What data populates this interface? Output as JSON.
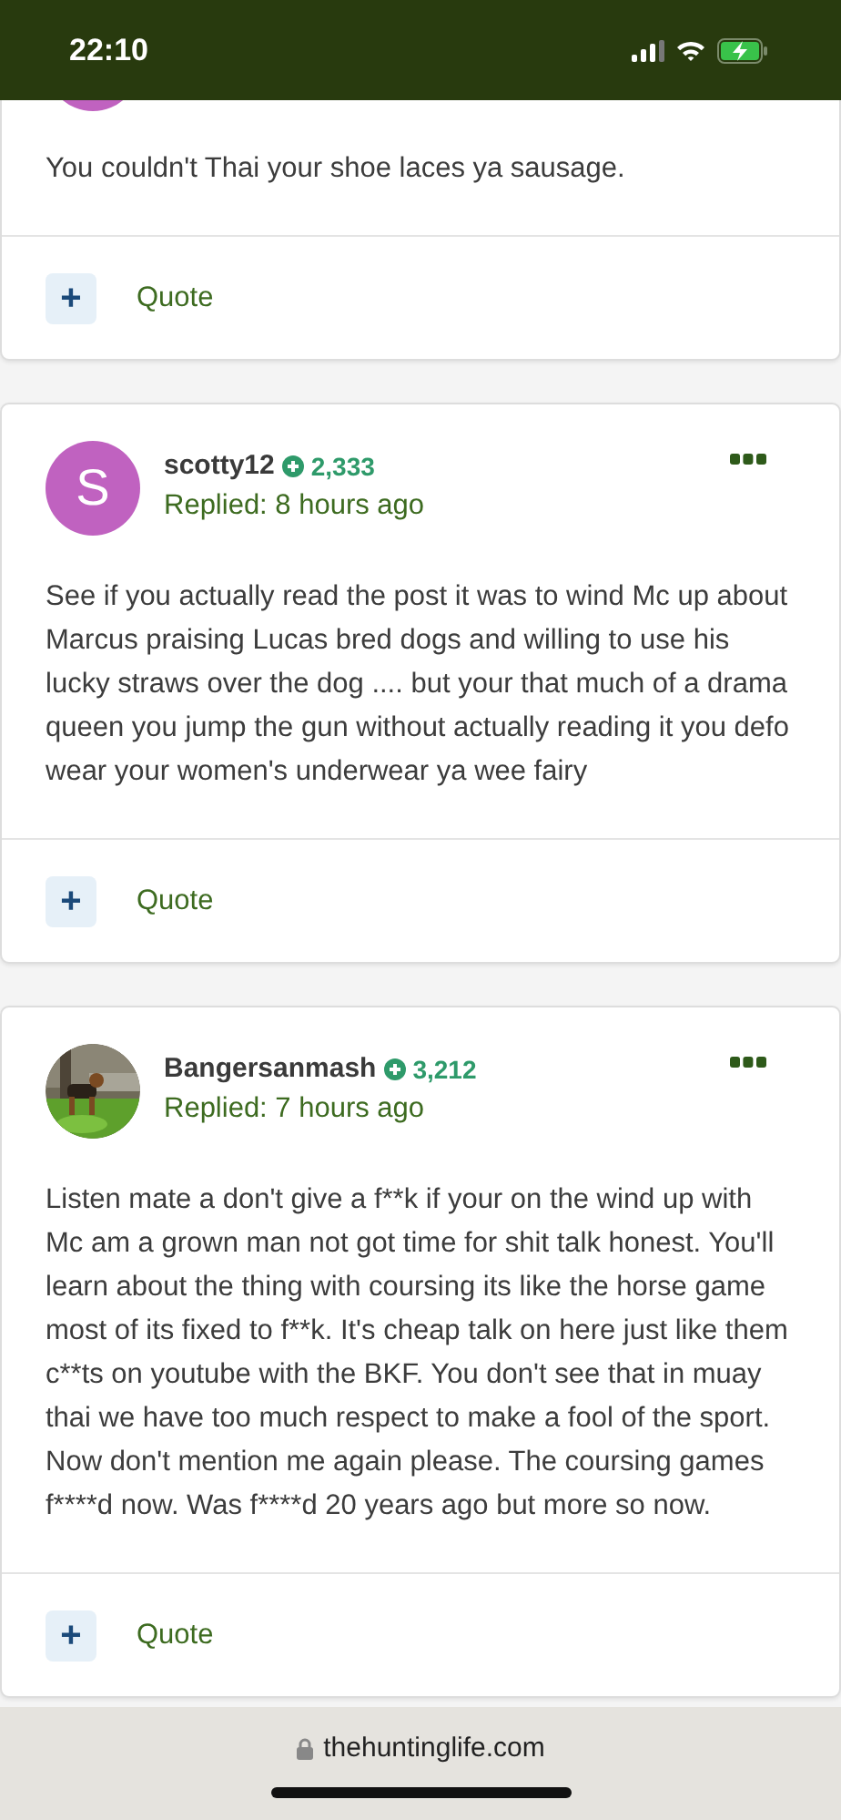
{
  "status_bar": {
    "time": "22:10",
    "battery_charging": true
  },
  "posts": [
    {
      "avatar": {
        "kind": "initial",
        "color": "#c062c0"
      },
      "body": "You couldn't Thai your shoe laces ya sausage.",
      "quote_label": "Quote",
      "quote_icon": "+"
    },
    {
      "avatar": {
        "kind": "initial",
        "letter": "S",
        "color": "#c062c0"
      },
      "author": "scotty12",
      "points": "2,333",
      "replied": "Replied: 8 hours ago",
      "body": "See if you actually read the post it was to wind Mc up about Marcus praising Lucas bred dogs and willing to use his lucky straws over the dog .... but your that much of a drama queen you jump the gun without actually reading it you defo wear your women's underwear ya wee fairy",
      "quote_label": "Quote",
      "quote_icon": "+"
    },
    {
      "author": "Bangersanmash",
      "points": "3,212",
      "replied": "Replied: 7 hours ago",
      "body": "Listen mate a don't give a f**k if your on the wind up with Mc am a grown man not got time for shit talk honest. You'll learn about the thing with coursing its like the horse game most of its fixed to f**k. It's cheap talk on here just like them c**ts on youtube with the BKF. You don't see that in muay thai we have too much respect to make a fool of the sport. Now don't mention me again please. The coursing games f****d now. Was f****d 20 years ago but more so now.",
      "quote_label": "Quote",
      "quote_icon": "+"
    }
  ],
  "browser_bar": {
    "url": "thehuntinglife.com",
    "secure": true
  }
}
